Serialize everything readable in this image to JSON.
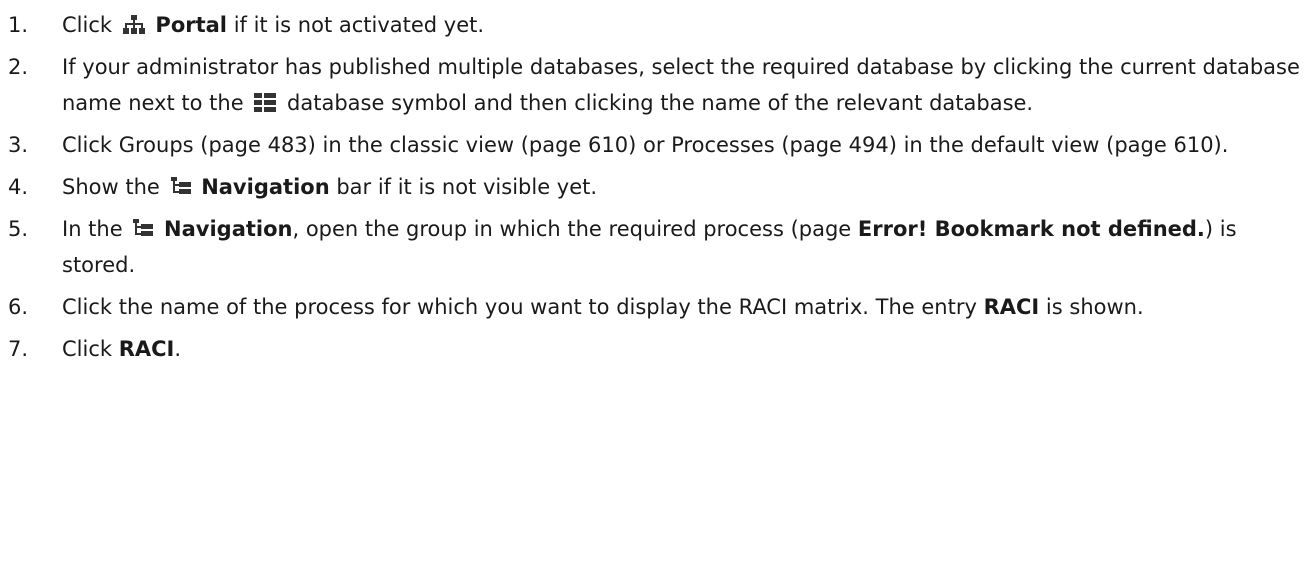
{
  "steps": [
    {
      "num": "1.",
      "pre": "Click",
      "icon": "portal-icon",
      "bold": "Portal",
      "post": " if it is not activated yet."
    },
    {
      "num": "2.",
      "pre": "If your administrator has published multiple databases, select the required database by clicking the current database name next to the",
      "icon": "database-icon",
      "post": "database symbol and then clicking the name of the relevant database."
    },
    {
      "num": "3.",
      "text": "Click Groups (page 483) in the classic view (page 610) or Processes (page 494) in the default view (page 610)."
    },
    {
      "num": "4.",
      "pre": "Show the",
      "icon": "navigation-icon",
      "bold": "Navigation",
      "post": " bar if it is not visible yet."
    },
    {
      "num": "5.",
      "pre": "In the",
      "icon": "navigation-icon",
      "bold": "Navigation",
      "mid": ", open the group in which the required process (page ",
      "bold2": "Error! Bookmark not defined.",
      "post": ") is stored."
    },
    {
      "num": "6.",
      "pre": "Click the name of the process for which you want to display the RACI matrix. The entry ",
      "bold": "RACI",
      "post": " is shown."
    },
    {
      "num": "7.",
      "pre": "Click ",
      "bold": "RACI",
      "post": "."
    }
  ],
  "colors": {
    "text": "#1a1a1a",
    "icon": "#333333"
  }
}
